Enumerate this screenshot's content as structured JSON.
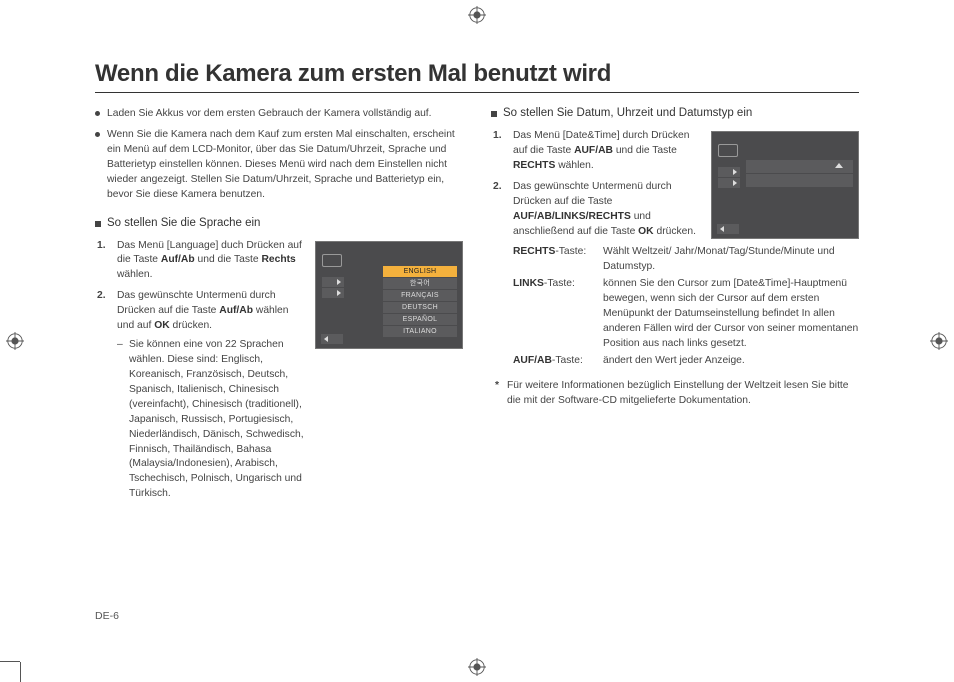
{
  "title": "Wenn die Kamera zum ersten Mal benutzt wird",
  "page_number": "DE-6",
  "intro_bullets": [
    "Laden Sie Akkus vor dem ersten Gebrauch der Kamera vollständig auf.",
    "Wenn Sie die Kamera nach dem Kauf zum ersten Mal einschalten, erscheint ein Menü auf dem LCD-Monitor, über das Sie Datum/Uhrzeit, Sprache und Batterietyp einstellen können. Dieses Menü wird nach dem Einstellen nicht wieder angezeigt. Stellen Sie Datum/Uhrzeit, Sprache und Batterietyp ein, bevor Sie diese Kamera benutzen."
  ],
  "lang_section": {
    "heading": "So stellen Sie die Sprache ein",
    "step1_pre": "Das Menü [Language] duch Drücken auf die Taste  ",
    "step1_b1": "Auf/Ab",
    "step1_mid": " und die Taste ",
    "step1_b2": "Rechts",
    "step1_post": " wählen.",
    "step2_pre": "Das gewünschte Untermenü durch Drücken auf die Taste ",
    "step2_b1": "Auf/Ab",
    "step2_mid": " wählen und auf ",
    "step2_b2": "OK",
    "step2_post": " drücken.",
    "dash": "Sie können eine von 22 Sprachen wählen. Diese sind: Englisch, Koreanisch, Französisch, Deutsch, Spanisch, Italienisch, Chinesisch (vereinfacht), Chinesisch (traditionell), Japanisch, Russisch, Portugiesisch, Niederländisch, Dänisch, Schwedisch, Finnisch, Thailändisch, Bahasa (Malaysia/Indonesien), Arabisch, Tschechisch, Polnisch, Ungarisch und Türkisch.",
    "menu_items": [
      "ENGLISH",
      "한국어",
      "FRANÇAIS",
      "DEUTSCH",
      "ESPAÑOL",
      "ITALIANO"
    ]
  },
  "dt_section": {
    "heading": "So stellen Sie Datum, Uhrzeit und Datumstyp ein",
    "step1_pre": "Das Menü [Date&Time] durch Drücken auf die Taste ",
    "step1_b1": "AUF/AB",
    "step1_mid": " und die Taste ",
    "step1_b2": "RECHTS",
    "step1_post": " wählen.",
    "step2_pre": "Das gewünschte Untermenü durch Drücken auf die Taste ",
    "step2_b1": "AUF/AB/LINKS/RECHTS",
    "step2_mid": " und anschließend auf die Taste ",
    "step2_b2": "OK",
    "step2_post": " drücken.",
    "keys": {
      "rechts_label": "RECHTS",
      "rechts_suffix": "-Taste:",
      "rechts_val": "Wählt Weltzeit/ Jahr/Monat/Tag/Stunde/Minute und Datumstyp.",
      "links_label": "LINKS",
      "links_suffix": "-Taste:",
      "links_val": "können Sie den Cursor zum [Date&Time]-Hauptmenü bewegen, wenn sich der Cursor auf dem ersten Menüpunkt der Datumseinstellung befindet In allen anderen Fällen wird der Cursor von seiner momentanen Position aus nach links gesetzt.",
      "aufab_label": "AUF/AB",
      "aufab_suffix": "-Taste:",
      "aufab_val": "ändert den Wert jeder Anzeige."
    }
  },
  "footnote_star": "*",
  "footnote": "Für weitere Informationen bezüglich Einstellung der Weltzeit lesen Sie bitte die mit der Software-CD mitgelieferte Dokumentation."
}
